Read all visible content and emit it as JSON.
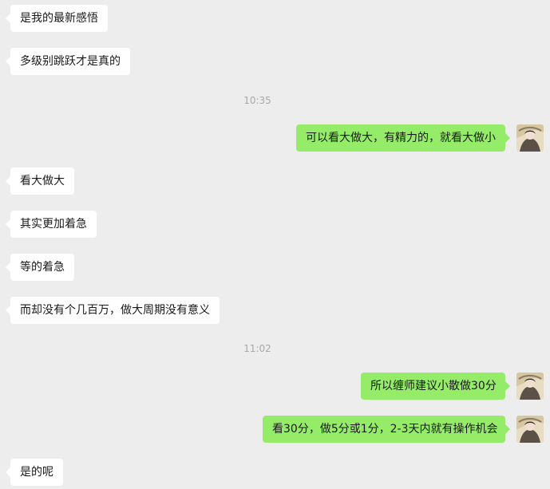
{
  "chat": {
    "messages": [
      {
        "text": "是我的最新感悟"
      },
      {
        "text": "多级别跳跃才是真的"
      },
      {
        "time": "10:35"
      },
      {
        "text": "可以看大做大，有精力的，就看大做小"
      },
      {
        "text": "看大做大"
      },
      {
        "text": "其实更加着急"
      },
      {
        "text": "等的着急"
      },
      {
        "text": "而却没有个几百万，做大周期没有意义"
      },
      {
        "time": "11:02"
      },
      {
        "text": "所以缠师建议小散做30分"
      },
      {
        "text": "看30分，做5分或1分，2-3天内就有操作机会"
      },
      {
        "text": "是的呢"
      }
    ]
  },
  "colors": {
    "background": "#ededed",
    "incoming_bubble": "#ffffff",
    "outgoing_bubble": "#95ec69",
    "timestamp_text": "#a8a8a8"
  },
  "icons": {
    "avatar": "user-avatar-icon"
  }
}
